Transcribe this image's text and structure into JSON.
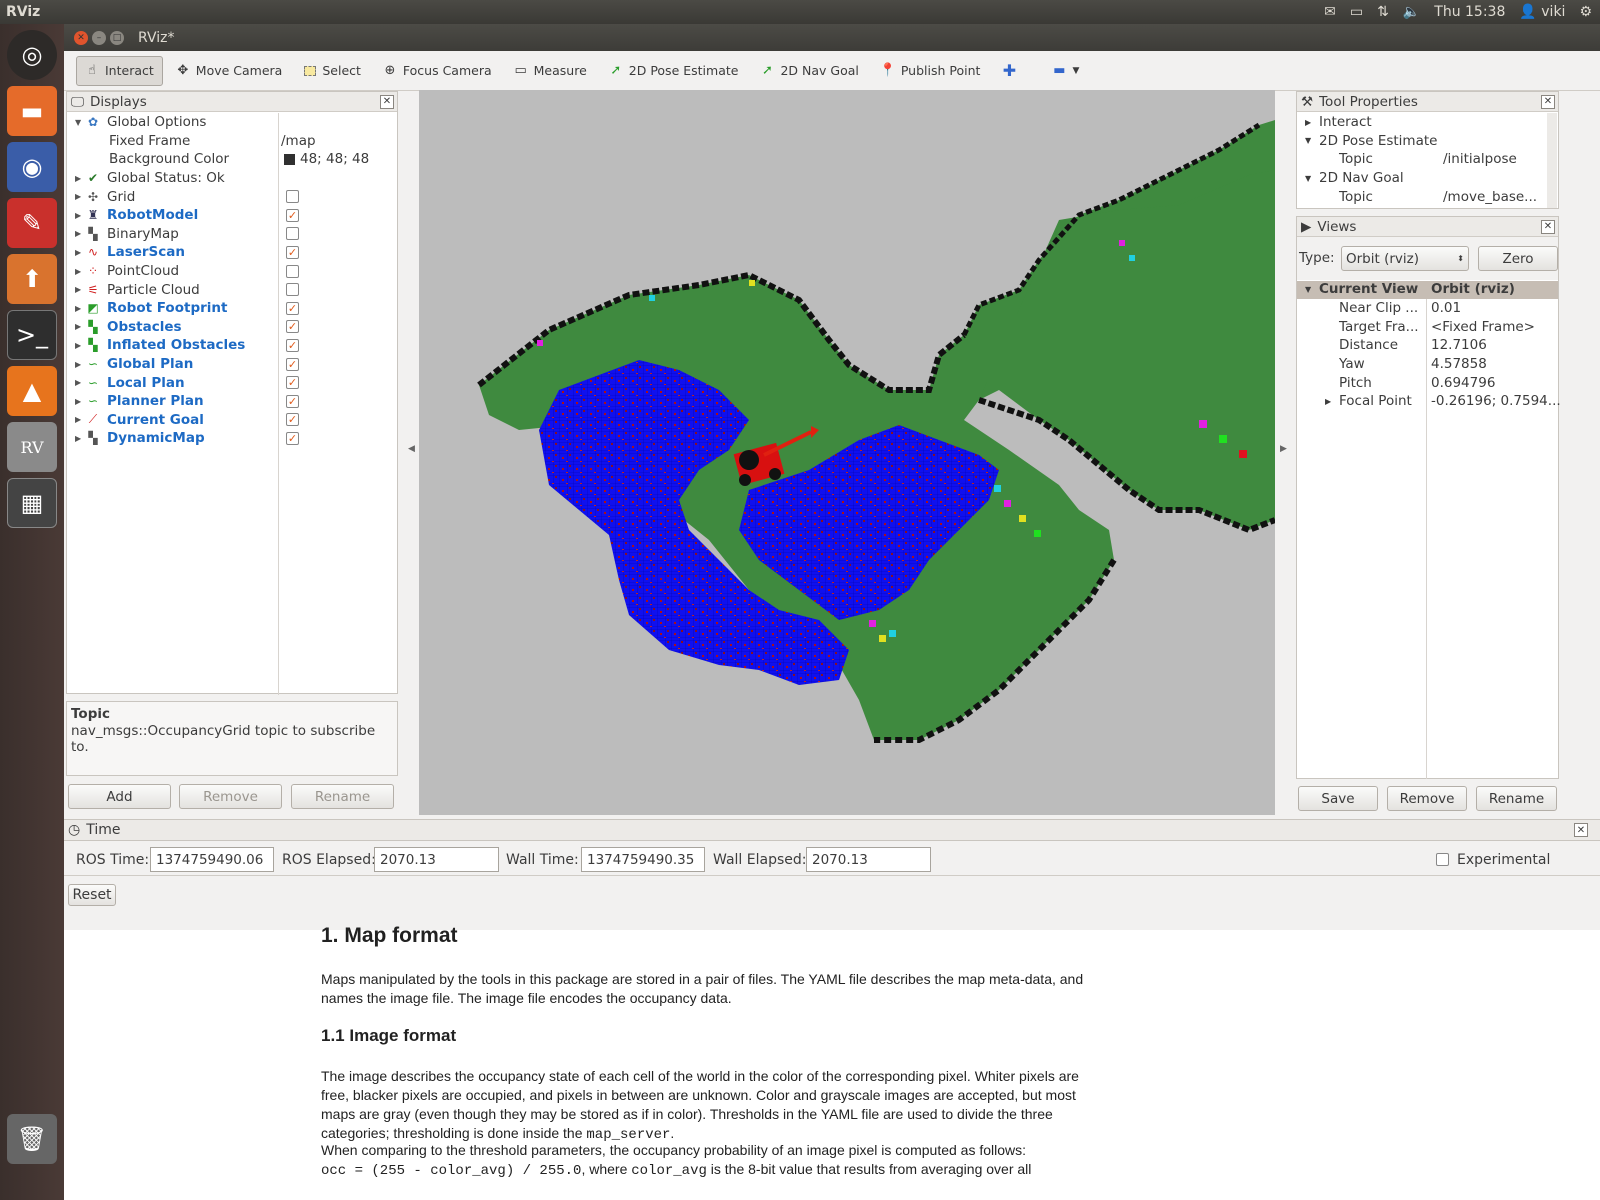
{
  "system": {
    "app_name": "RViz",
    "clock": "Thu 15:38",
    "user": "viki"
  },
  "window": {
    "title": "RViz*"
  },
  "toolbar": {
    "tools": [
      {
        "label": "Interact",
        "icon": "hand-pointer-icon",
        "active": true
      },
      {
        "label": "Move Camera",
        "icon": "move-camera-icon"
      },
      {
        "label": "Select",
        "icon": "select-rectangle-icon"
      },
      {
        "label": "Focus Camera",
        "icon": "focus-camera-icon"
      },
      {
        "label": "Measure",
        "icon": "ruler-icon"
      },
      {
        "label": "2D Pose Estimate",
        "icon": "green-arrow-icon"
      },
      {
        "label": "2D Nav Goal",
        "icon": "green-arrow-icon"
      },
      {
        "label": "Publish Point",
        "icon": "map-pin-icon"
      }
    ]
  },
  "displays": {
    "title": "Displays",
    "global_options": "Global Options",
    "fixed_frame_label": "Fixed Frame",
    "fixed_frame_value": "/map",
    "bg_color_label": "Background Color",
    "bg_color_value": "48; 48; 48",
    "global_status": "Global Status: Ok",
    "items": [
      {
        "label": "Grid",
        "checked": false,
        "enabled": false
      },
      {
        "label": "RobotModel",
        "checked": true,
        "enabled": true
      },
      {
        "label": "BinaryMap",
        "checked": false,
        "enabled": false
      },
      {
        "label": "LaserScan",
        "checked": true,
        "enabled": true
      },
      {
        "label": "PointCloud",
        "checked": false,
        "enabled": false
      },
      {
        "label": "Particle Cloud",
        "checked": false,
        "enabled": false
      },
      {
        "label": "Robot Footprint",
        "checked": true,
        "enabled": true
      },
      {
        "label": "Obstacles",
        "checked": true,
        "enabled": true
      },
      {
        "label": "Inflated Obstacles",
        "checked": true,
        "enabled": true
      },
      {
        "label": "Global Plan",
        "checked": true,
        "enabled": true
      },
      {
        "label": "Local Plan",
        "checked": true,
        "enabled": true
      },
      {
        "label": "Planner Plan",
        "checked": true,
        "enabled": true
      },
      {
        "label": "Current Goal",
        "checked": true,
        "enabled": true
      },
      {
        "label": "DynamicMap",
        "checked": true,
        "enabled": true
      }
    ],
    "desc_title": "Topic",
    "desc_text": "nav_msgs::OccupancyGrid topic to subscribe to.",
    "add": "Add",
    "remove": "Remove",
    "rename": "Rename"
  },
  "tool_properties": {
    "title": "Tool Properties",
    "rows": [
      {
        "label": "Interact",
        "value": "",
        "indent": 0,
        "arrow": "right"
      },
      {
        "label": "2D Pose Estimate",
        "value": "",
        "indent": 0,
        "arrow": "down"
      },
      {
        "label": "Topic",
        "value": "/initialpose",
        "indent": 1,
        "arrow": ""
      },
      {
        "label": "2D Nav Goal",
        "value": "",
        "indent": 0,
        "arrow": "down"
      },
      {
        "label": "Topic",
        "value": "/move_base...",
        "indent": 1,
        "arrow": ""
      }
    ]
  },
  "views": {
    "title": "Views",
    "type_label": "Type:",
    "type_value": "Orbit (rviz)",
    "zero": "Zero",
    "header_label": "Current View",
    "header_value": "Orbit (rviz)",
    "rows": [
      {
        "label": "Near Clip ...",
        "value": "0.01"
      },
      {
        "label": "Target Fra...",
        "value": "<Fixed Frame>"
      },
      {
        "label": "Distance",
        "value": "12.7106"
      },
      {
        "label": "Yaw",
        "value": "4.57858"
      },
      {
        "label": "Pitch",
        "value": "0.694796"
      },
      {
        "label": "Focal Point",
        "value": "-0.26196; 0.7594..."
      }
    ],
    "save": "Save",
    "remove": "Remove",
    "rename": "Rename"
  },
  "time": {
    "title": "Time",
    "ros_time_label": "ROS Time:",
    "ros_time": "1374759490.06",
    "ros_elapsed_label": "ROS Elapsed:",
    "ros_elapsed": "2070.13",
    "wall_time_label": "Wall Time:",
    "wall_time": "1374759490.35",
    "wall_elapsed_label": "Wall Elapsed:",
    "wall_elapsed": "2070.13",
    "experimental": "Experimental",
    "reset": "Reset"
  },
  "doc": {
    "h1": "1. Map format",
    "p1": "Maps manipulated by the tools in this package are stored in a pair of files. The YAML file describes the map meta-data, and names the image file. The image file encodes the occupancy data.",
    "h2": "1.1 Image format",
    "p2": "The image describes the occupancy state of each cell of the world in the color of the corresponding pixel. Whiter pixels are free, blacker pixels are occupied, and pixels in between are unknown. Color and grayscale images are accepted, but most maps are gray (even though they may be stored as if in color). Thresholds in the YAML file are used to divide the three categories; thresholding is done inside the",
    "p2_code": "map_server",
    "p3": "When comparing to the threshold parameters, the occupancy probability of an image pixel is computed as follows:",
    "p4_code": "occ = (255 - color_avg) / 255.0",
    "p4_mid": ", where",
    "p4_code2": "color_avg",
    "p4_tail": "is the 8-bit value that results from averaging over all"
  },
  "colors": {
    "map_free": "#3f8a3f",
    "inflated": "#1010ee",
    "obstacle": "#000000",
    "viewport_bg": "#bcbcbc"
  }
}
